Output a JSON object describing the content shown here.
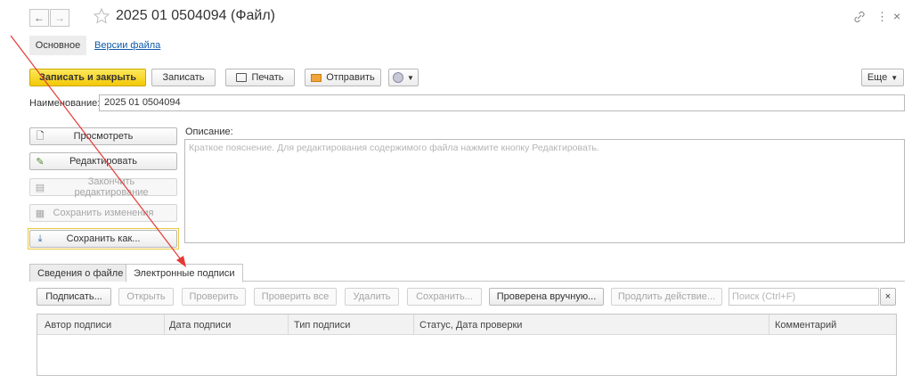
{
  "header": {
    "title": "2025 01 0504094 (Файл)",
    "more_icon": "⋮",
    "close_icon": "×",
    "link_icon": "link-icon",
    "star_icon": "star-icon"
  },
  "form_tabs": {
    "main": "Основное",
    "versions": "Версии файла"
  },
  "toolbar": {
    "save_close": "Записать и закрыть",
    "save": "Записать",
    "print": "Печать",
    "send": "Отправить",
    "more": "Еще"
  },
  "name_field": {
    "label": "Наименование:",
    "value": "2025 01 0504094"
  },
  "actions": {
    "view": "Просмотреть",
    "edit": "Редактировать",
    "finish_edit": "Закончить редактирование",
    "save_changes": "Сохранить изменения",
    "save_as": "Сохранить как..."
  },
  "description": {
    "label": "Описание:",
    "placeholder": "Краткое пояснение. Для редактирования содержимого файла нажмите кнопку Редактировать."
  },
  "tabs": {
    "file_info": "Сведения о файле",
    "signatures": "Электронные подписи"
  },
  "sig_toolbar": {
    "sign": "Подписать...",
    "open": "Открыть",
    "verify": "Проверить",
    "verify_all": "Проверить все",
    "delete": "Удалить",
    "save": "Сохранить...",
    "verified_manually": "Проверена вручную...",
    "extend": "Продлить действие...",
    "search_placeholder": "Поиск (Ctrl+F)",
    "search_clear": "×"
  },
  "table": {
    "columns": [
      "Автор подписи",
      "Дата подписи",
      "Тип подписи",
      "Статус, Дата проверки",
      "Комментарий"
    ]
  },
  "colors": {
    "accent_yellow": "#f3c806",
    "annotation_red": "#e53935",
    "link_blue": "#0f5aa8"
  }
}
